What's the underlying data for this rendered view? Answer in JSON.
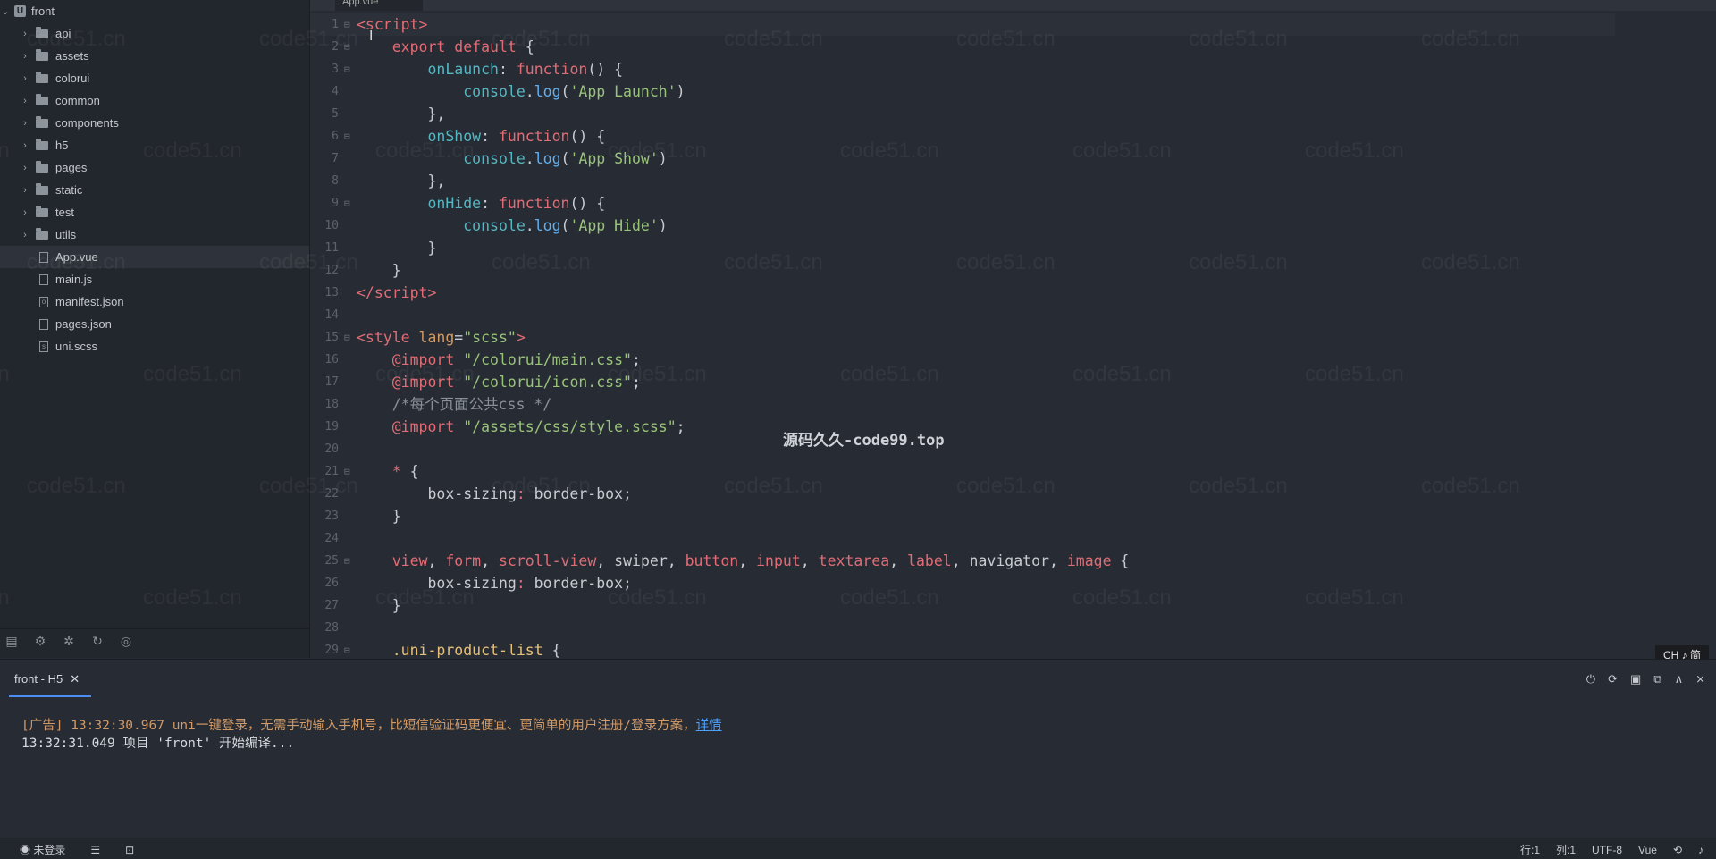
{
  "project": {
    "name": "front",
    "root_icon": "U"
  },
  "file_tree": [
    {
      "label": "api",
      "type": "folder"
    },
    {
      "label": "assets",
      "type": "folder"
    },
    {
      "label": "colorui",
      "type": "folder"
    },
    {
      "label": "common",
      "type": "folder"
    },
    {
      "label": "components",
      "type": "folder"
    },
    {
      "label": "h5",
      "type": "folder"
    },
    {
      "label": "pages",
      "type": "folder"
    },
    {
      "label": "static",
      "type": "folder"
    },
    {
      "label": "test",
      "type": "folder"
    },
    {
      "label": "utils",
      "type": "folder"
    },
    {
      "label": "App.vue",
      "type": "file",
      "icon": "",
      "selected": true
    },
    {
      "label": "main.js",
      "type": "file",
      "icon": ""
    },
    {
      "label": "manifest.json",
      "type": "file",
      "icon": "o"
    },
    {
      "label": "pages.json",
      "type": "file",
      "icon": ""
    },
    {
      "label": "uni.scss",
      "type": "file",
      "icon": "s"
    }
  ],
  "editor": {
    "tab": "App.vue",
    "line_numbers": [
      "1",
      "2",
      "3",
      "4",
      "5",
      "6",
      "7",
      "8",
      "9",
      "10",
      "11",
      "12",
      "13",
      "14",
      "15",
      "16",
      "17",
      "18",
      "19",
      "20",
      "21",
      "22",
      "23",
      "24",
      "25",
      "26",
      "27",
      "28",
      "29"
    ]
  },
  "watermark": {
    "text": "code51.cn",
    "center": "源码久久-code99.top"
  },
  "panel": {
    "tab_label": "front - H5",
    "log_line1_prefix": "[广告] 13:32:30.967 ",
    "log_line1_text": "uni一键登录，无需手动输入手机号，比短信验证码更便宜、更简单的用户注册/登录方案，",
    "log_line1_link": "详情",
    "log_line2": "13:32:31.049 项目 'front' 开始编译..."
  },
  "ime": {
    "label": "CH ♪ 简"
  },
  "status": {
    "login": "未登录",
    "row": "行:1",
    "col": "列:1",
    "encoding": "UTF-8",
    "language": "Vue"
  },
  "colors": {
    "accent": "#4f8cf0",
    "tag": "#e06c75",
    "string": "#98c379",
    "function": "#61afef"
  }
}
